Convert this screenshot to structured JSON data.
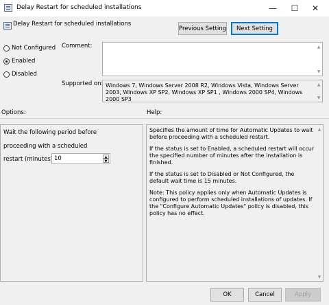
{
  "window": {
    "title": "Delay Restart for scheduled installations",
    "minimize_glyph": "—",
    "maximize_glyph": "☐",
    "close_glyph": "✕"
  },
  "header": {
    "policy_name": "Delay Restart for scheduled installations",
    "previous_setting": "Previous Setting",
    "next_setting": "Next Setting"
  },
  "state": {
    "options": [
      {
        "label": "Not Configured",
        "checked": false
      },
      {
        "label": "Enabled",
        "checked": true
      },
      {
        "label": "Disabled",
        "checked": false
      }
    ]
  },
  "comment": {
    "label": "Comment:",
    "value": ""
  },
  "supported": {
    "label": "Supported on:",
    "value": "Windows 7, Windows Server 2008 R2, Windows Vista, Windows Server 2003, Windows XP SP2, Windows XP SP1 , Windows 2000 SP4, Windows 2000 SP3"
  },
  "options_panel": {
    "header": "Options:",
    "line1": "Wait the following period before",
    "line2": "proceeding with a scheduled",
    "line3": "restart (minutes):",
    "restart_minutes": "10"
  },
  "help_panel": {
    "header": "Help:",
    "paragraphs": [
      "Specifies the amount of time for Automatic Updates to wait before proceeding with a scheduled restart.",
      "If the status is set to Enabled, a scheduled restart will occur the specified number of minutes after the installation is finished.",
      "If the status is set to Disabled or Not Configured, the default wait time is 15 minutes.",
      "Note: This policy applies only when Automatic Updates is configured to perform scheduled installations of updates. If the \"Configure Automatic Updates\" policy is disabled, this policy has no effect."
    ]
  },
  "footer": {
    "ok": "OK",
    "cancel": "Cancel",
    "apply": "Apply"
  }
}
